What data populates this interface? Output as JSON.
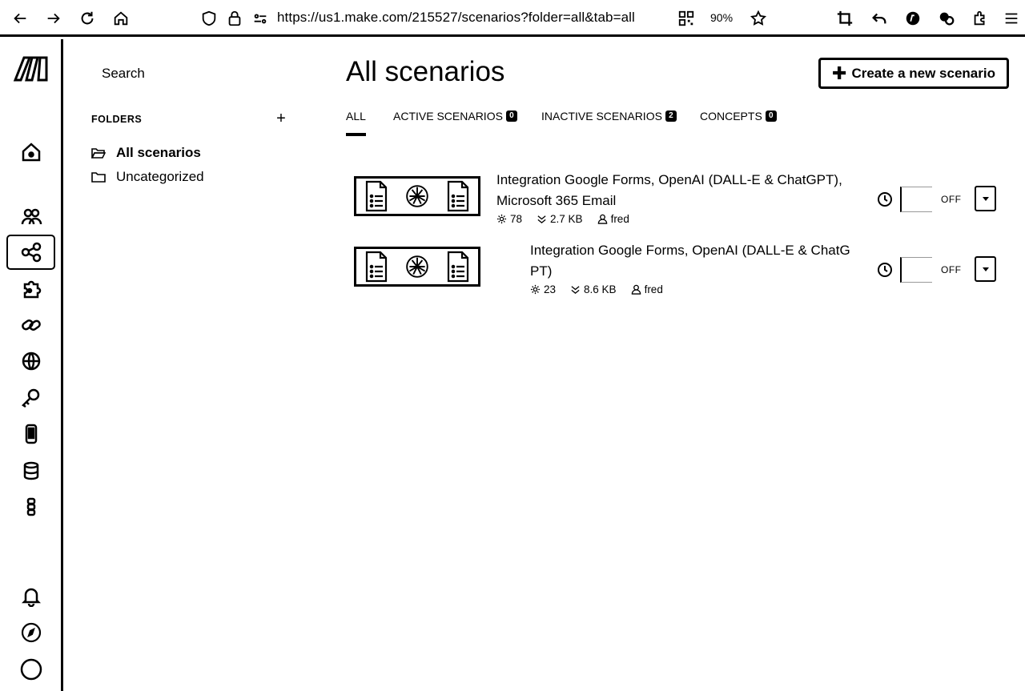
{
  "browser": {
    "url": "https://us1.make.com/215527/scenarios?folder=all&tab=all",
    "zoom": "90%"
  },
  "sidebar": {
    "search_label": "Search",
    "folders_heading": "FOLDERS",
    "add_folder": "+",
    "folders": [
      {
        "label": "All scenarios",
        "selected": true
      },
      {
        "label": "Uncategorized",
        "selected": false
      }
    ]
  },
  "main": {
    "title": "All scenarios",
    "create_button": "Create a new scenario",
    "tabs": [
      {
        "label": "ALL",
        "count": null
      },
      {
        "label": "ACTIVE SCENARIOS",
        "count": "0"
      },
      {
        "label": "INACTIVE SCENARIOS",
        "count": "2"
      },
      {
        "label": "CONCEPTS",
        "count": "0"
      }
    ],
    "scenarios": [
      {
        "title_line1": "Integration Google Forms, OpenAI (DALL-E & ChatGPT),",
        "title_line2": "Microsoft 365 Email",
        "operations": "78",
        "size": "2.7 KB",
        "owner": "fred",
        "status": "OFF"
      },
      {
        "title_line1": "Integration Google Forms, OpenAI (DALL-E & ChatG",
        "title_line2": "PT)",
        "operations": "23",
        "size": "8.6 KB",
        "owner": "fred",
        "status": "OFF"
      }
    ]
  },
  "icons": {
    "rail": [
      "make-logo",
      "home-icon",
      "team-icon",
      "scenarios-icon",
      "templates-icon",
      "connections-icon",
      "webhooks-icon",
      "keys-icon",
      "devices-icon",
      "datastores-icon",
      "data-structures-icon",
      "notifications-icon",
      "help-icon",
      "profile-icon"
    ]
  }
}
